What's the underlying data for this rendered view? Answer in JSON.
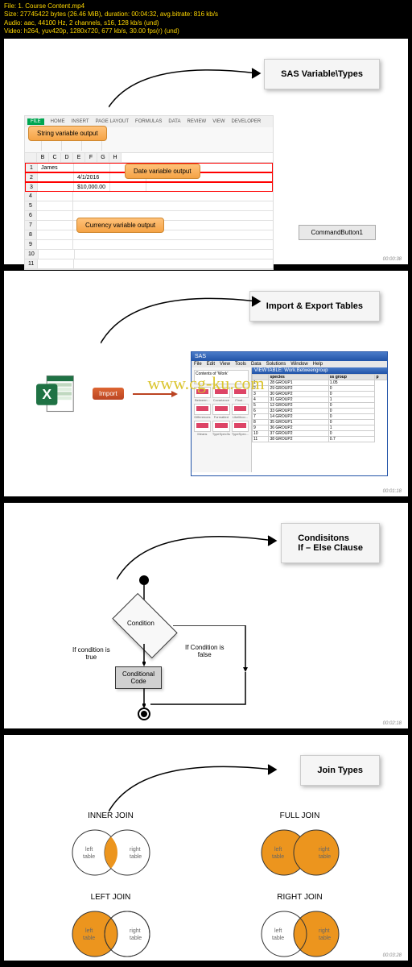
{
  "info": {
    "l1": "File: 1. Course Content.mp4",
    "l2": "Size: 27745422 bytes (26.46 MiB), duration: 00:04:32, avg.bitrate: 816 kb/s",
    "l3": "Audio: aac, 44100 Hz, 2 channels, s16, 128 kb/s (und)",
    "l4": "Video: h264, yuv420p, 1280x720, 677 kb/s, 30.00 fps(r) (und)"
  },
  "p1": {
    "title": "SAS Variable\\Types",
    "tabs": [
      "FILE",
      "HOME",
      "INSERT",
      "PAGE LAYOUT",
      "FORMULAS",
      "DATA",
      "REVIEW",
      "VIEW",
      "DEVELOPER"
    ],
    "c1": "String variable output",
    "c2": "Date variable output",
    "c3": "Currency variable output",
    "btn": "CommandButton1",
    "name": "James",
    "date": "4/1/2016",
    "curr": "$10,000.00",
    "ts": "00:00:38"
  },
  "p2": {
    "title": "Import & Export Tables",
    "imp": "Import",
    "sas_title": "SAS",
    "menu": [
      "File",
      "Edit",
      "View",
      "Tools",
      "Data",
      "Solutions",
      "Window",
      "Help"
    ],
    "tree": "Contents of 'Work'",
    "thumbs": [
      "Between...",
      "Covariance",
      "Final...",
      "Differences",
      "Formatted",
      "Likelihoo...",
      "Means",
      "TypeSpec3s",
      "TypeSpec..."
    ],
    "vt": "VIEWTABLE: Work.Betweengroup",
    "cols": [
      "",
      "species",
      "ss group",
      "p"
    ],
    "rows": [
      [
        "1",
        "28 GROUP1",
        "1.05"
      ],
      [
        "2",
        "29 GROUP2",
        "0"
      ],
      [
        "3",
        "30 GROUP2",
        "0"
      ],
      [
        "4",
        "31 GROUP2",
        "1"
      ],
      [
        "5",
        "12 GROUP2",
        "0"
      ],
      [
        "6",
        "33 GROUP2",
        "0"
      ],
      [
        "7",
        "14 GROUP2",
        "0"
      ],
      [
        "8",
        "35 GROUP1",
        "0"
      ],
      [
        "9",
        "36 GROUP2",
        "1"
      ],
      [
        "10",
        "37 GROUP2",
        "0"
      ],
      [
        "11",
        "38 GROUP2",
        "0.7"
      ]
    ],
    "wm": "www.cg-ku.com",
    "ts": "00:01:18"
  },
  "p3": {
    "title": "Condisitons\nIf – Else Clause",
    "cond": "Condition",
    "true": "If condition is\ntrue",
    "false": "If Condition is\nfalse",
    "box": "Conditional\nCode",
    "ts": "00:02:18"
  },
  "p4": {
    "title": "Join Types",
    "j": [
      "INNER JOIN",
      "FULL JOIN",
      "LEFT JOIN",
      "RIGHT JOIN"
    ],
    "lt": "left\ntable",
    "rt": "right\ntable",
    "ts": "00:03:28"
  }
}
